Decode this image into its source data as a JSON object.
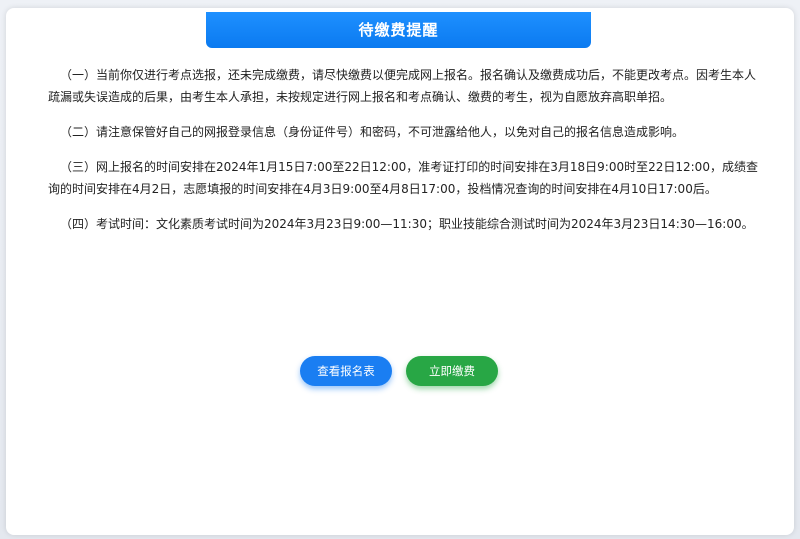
{
  "dialog": {
    "title": "待缴费提醒"
  },
  "paragraphs": [
    "（一）当前你仅进行考点选报，还未完成缴费，请尽快缴费以便完成网上报名。报名确认及缴费成功后，不能更改考点。因考生本人疏漏或失误造成的后果，由考生本人承担，未按规定进行网上报名和考点确认、缴费的考生，视为自愿放弃高职单招。",
    "（二）请注意保管好自己的网报登录信息（身份证件号）和密码，不可泄露给他人，以免对自己的报名信息造成影响。",
    "（三）网上报名的时间安排在2024年1月15日7:00至22日12:00，准考证打印的时间安排在3月18日9:00时至22日12:00，成绩查询的时间安排在4月2日，志愿填报的时间安排在4月3日9:00至4月8日17:00，投档情况查询的时间安排在4月10日17:00后。",
    "（四）考试时间：文化素质考试时间为2024年3月23日9:00—11:30；职业技能综合测试时间为2024年3月23日14:30—16:00。"
  ],
  "buttons": {
    "view_form": "查看报名表",
    "pay_now": "立即缴费"
  },
  "colors": {
    "title_bg": "#1e90ff",
    "view_button": "#1a7ef2",
    "pay_button": "#28a745"
  }
}
